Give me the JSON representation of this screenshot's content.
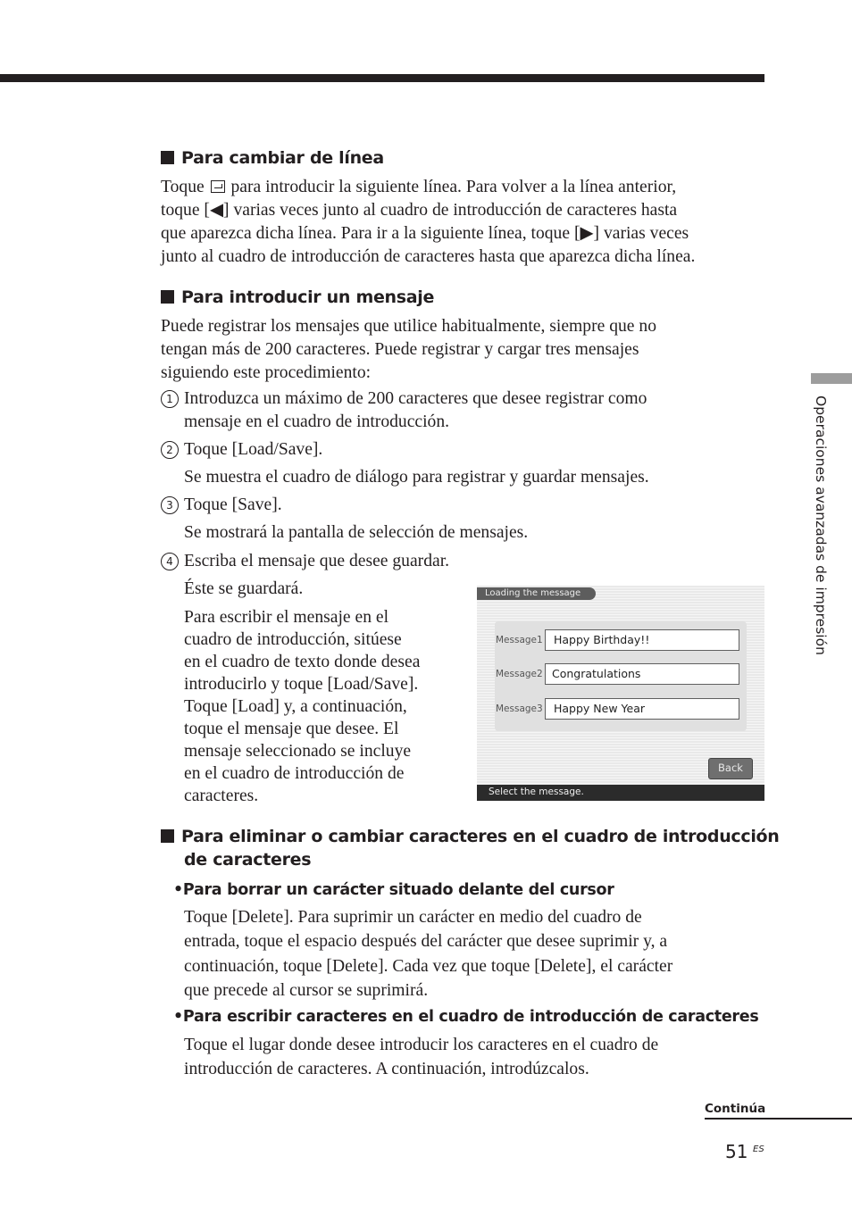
{
  "sections": {
    "cambiar_linea": {
      "heading": "Para cambiar de línea",
      "lines": [
        [
          "Toque ",
          "enter-icon",
          " para introducir la siguiente línea. Para volver a la línea anterior,"
        ],
        "toque [◀] varias veces junto al cuadro de introducción de caracteres hasta",
        "que aparezca dicha línea. Para ir a la siguiente línea, toque [▶] varias veces",
        "junto al cuadro de introducción de caracteres hasta que aparezca dicha línea."
      ],
      "line1_prefix": "Toque",
      "line1_suffix": "para introducir la siguiente línea. Para volver a la línea anterior,"
    },
    "introducir_mensaje": {
      "heading": "Para introducir un mensaje",
      "intro": [
        "Puede registrar los mensajes que utilice habitualmente, siempre que no",
        "tengan más de 200 caracteres. Puede registrar y cargar tres mensajes",
        "siguiendo este procedimiento:"
      ],
      "steps": [
        {
          "num": "1",
          "lines": [
            "Introduzca un máximo de 200 caracteres que desee registrar como",
            "mensaje en el cuadro de introducción."
          ]
        },
        {
          "num": "2",
          "lines": [
            "Toque [Load/Save]."
          ],
          "note": "Se muestra el cuadro de diálogo para registrar y guardar mensajes."
        },
        {
          "num": "3",
          "lines": [
            "Toque [Save]."
          ],
          "note": "Se mostrará la pantalla de selección de mensajes."
        },
        {
          "num": "4",
          "lines": [
            "Escriba el mensaje que desee guardar."
          ],
          "note": "Éste se guardará."
        }
      ],
      "load_paragraph": [
        "Para escribir el mensaje en el",
        "cuadro de introducción, sitúese",
        "en el cuadro de texto donde desea",
        "introducirlo y toque [Load/Save].",
        "Toque [Load] y, a continuación,",
        "toque el mensaje que desee. El",
        "mensaje seleccionado se incluye",
        "en el cuadro de introducción de",
        "caracteres."
      ]
    },
    "eliminar": {
      "heading_lines": [
        "Para eliminar o cambiar caracteres en el cuadro de introducción",
        "de caracteres"
      ],
      "subsections": [
        {
          "heading": "•Para borrar un carácter situado delante del cursor",
          "lines": [
            "Toque [Delete]. Para suprimir un carácter en medio del cuadro de",
            "entrada, toque el espacio después del carácter que desee suprimir y, a",
            "continuación, toque [Delete]. Cada vez que toque [Delete], el carácter",
            "que precede al cursor se suprimirá."
          ]
        },
        {
          "heading": "•Para escribir caracteres en el cuadro de introducción de caracteres",
          "lines": [
            "Toque el lugar donde desee introducir los caracteres en el cuadro de",
            "introducción de caracteres. A continuación, introdúzcalos."
          ]
        }
      ]
    }
  },
  "screenshot": {
    "title": "Loading the message",
    "messages": [
      {
        "label": "Message1",
        "value": "Happy Birthday!!"
      },
      {
        "label": "Message2",
        "value": "Congratulations"
      },
      {
        "label": "Message3",
        "value": "Happy New Year"
      }
    ],
    "back_label": "Back",
    "status": "Select the message."
  },
  "side_tab": "Operaciones avanzadas de impresión",
  "footer": {
    "continua": "Continúa",
    "page_number": "51",
    "lang": "ES"
  }
}
